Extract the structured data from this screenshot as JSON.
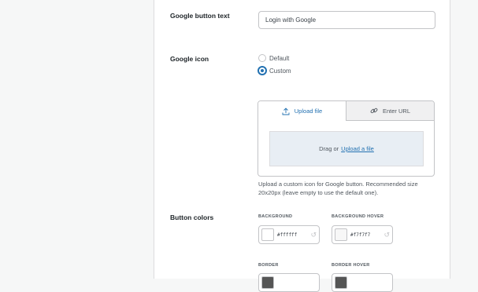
{
  "google_button_text": {
    "label": "Google button text",
    "value": "Login with Google"
  },
  "google_icon": {
    "label": "Google icon",
    "options": [
      "Default",
      "Custom"
    ],
    "selected": "Custom",
    "tabs": {
      "upload": "Upload file",
      "url": "Enter URL"
    },
    "dropzone": {
      "prefix": "Drag or",
      "link": "Upload a file"
    },
    "help": "Upload a custom icon for Google button. Recommended size 20x20px (leave empty to use the default one)."
  },
  "button_colors": {
    "label": "Button colors",
    "background": {
      "label": "BACKGROUND",
      "value": "#ffffff"
    },
    "background_hover": {
      "label": "BACKGROUND HOVER",
      "value": "#f7f7f7"
    },
    "border": {
      "label": "BORDER"
    },
    "border_hover": {
      "label": "BORDER HOVER"
    }
  },
  "colors": {
    "accent": "#2271b1",
    "dark_swatch": "#555555"
  }
}
